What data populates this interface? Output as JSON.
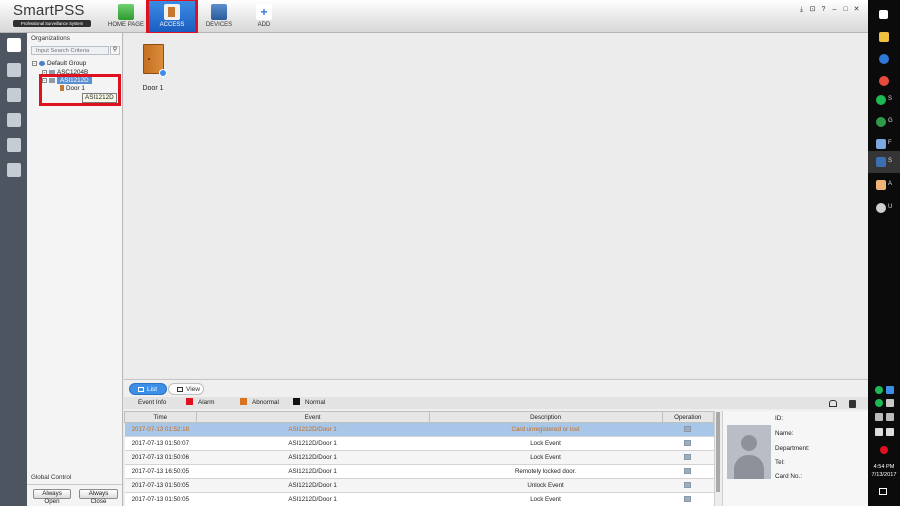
{
  "app": {
    "name": "SmartPSS",
    "tagline": "Professional Surveillance System"
  },
  "nav": {
    "home": "HOME PAGE",
    "access": "ACCESS",
    "devices": "DEVICES",
    "add": "ADD"
  },
  "window_controls": [
    "⤓",
    "⊡",
    "?",
    "–",
    "□",
    "✕"
  ],
  "organizations": {
    "title": "Organizations",
    "search_placeholder": "Input Search Criteria",
    "tree": {
      "root": "Default Group",
      "device1": "ASC1204B",
      "device2": "ASI1212D",
      "door": "Door 1"
    },
    "tooltip": "ASI1212D"
  },
  "global_control": {
    "title": "Global Control",
    "always_open": "Always Open",
    "always_close": "Always Close"
  },
  "main": {
    "door_name": "Door 1"
  },
  "bottom": {
    "tabs": {
      "list": "List",
      "view": "View"
    },
    "legend": {
      "title": "Event Info",
      "alarm": "Alarm",
      "abnormal": "Abnormal",
      "normal": "Normal",
      "alarm_color": "#e0111e",
      "abnormal_color": "#d8741f",
      "normal_color": "#111111"
    },
    "columns": [
      "Time",
      "Event",
      "Description",
      "Operation"
    ],
    "rows": [
      {
        "time": "2017-07-13 01:52:18",
        "event": "ASI1212D/Door 1",
        "description": "Card unregistered or lost"
      },
      {
        "time": "2017-07-13 01:50:07",
        "event": "ASI1212D/Door 1",
        "description": "Lock Event"
      },
      {
        "time": "2017-07-13 01:50:06",
        "event": "ASI1212D/Door 1",
        "description": "Lock Event"
      },
      {
        "time": "2017-07-13 16:50:05",
        "event": "ASI1212D/Door 1",
        "description": "Remotely locked door."
      },
      {
        "time": "2017-07-13 01:50:05",
        "event": "ASI1212D/Door 1",
        "description": "Unlock Event"
      },
      {
        "time": "2017-07-13 01:50:05",
        "event": "ASI1212D/Door 1",
        "description": "Lock Event"
      }
    ],
    "detail": {
      "id": "ID:",
      "name": "Name:",
      "department": "Department:",
      "tel": "Tel:",
      "card_no": "Card No.:"
    }
  },
  "taskbar": {
    "apps": [
      {
        "label": "S",
        "icon": "spotify-icon"
      },
      {
        "label": "G",
        "icon": "chat-icon"
      },
      {
        "label": "F",
        "icon": "app-icon"
      },
      {
        "label": "S",
        "icon": "smartpss-icon"
      },
      {
        "label": "A",
        "icon": "app-icon"
      },
      {
        "label": "U",
        "icon": "app-icon"
      }
    ],
    "clock_time": "4:54 PM",
    "clock_date": "7/13/2017"
  }
}
